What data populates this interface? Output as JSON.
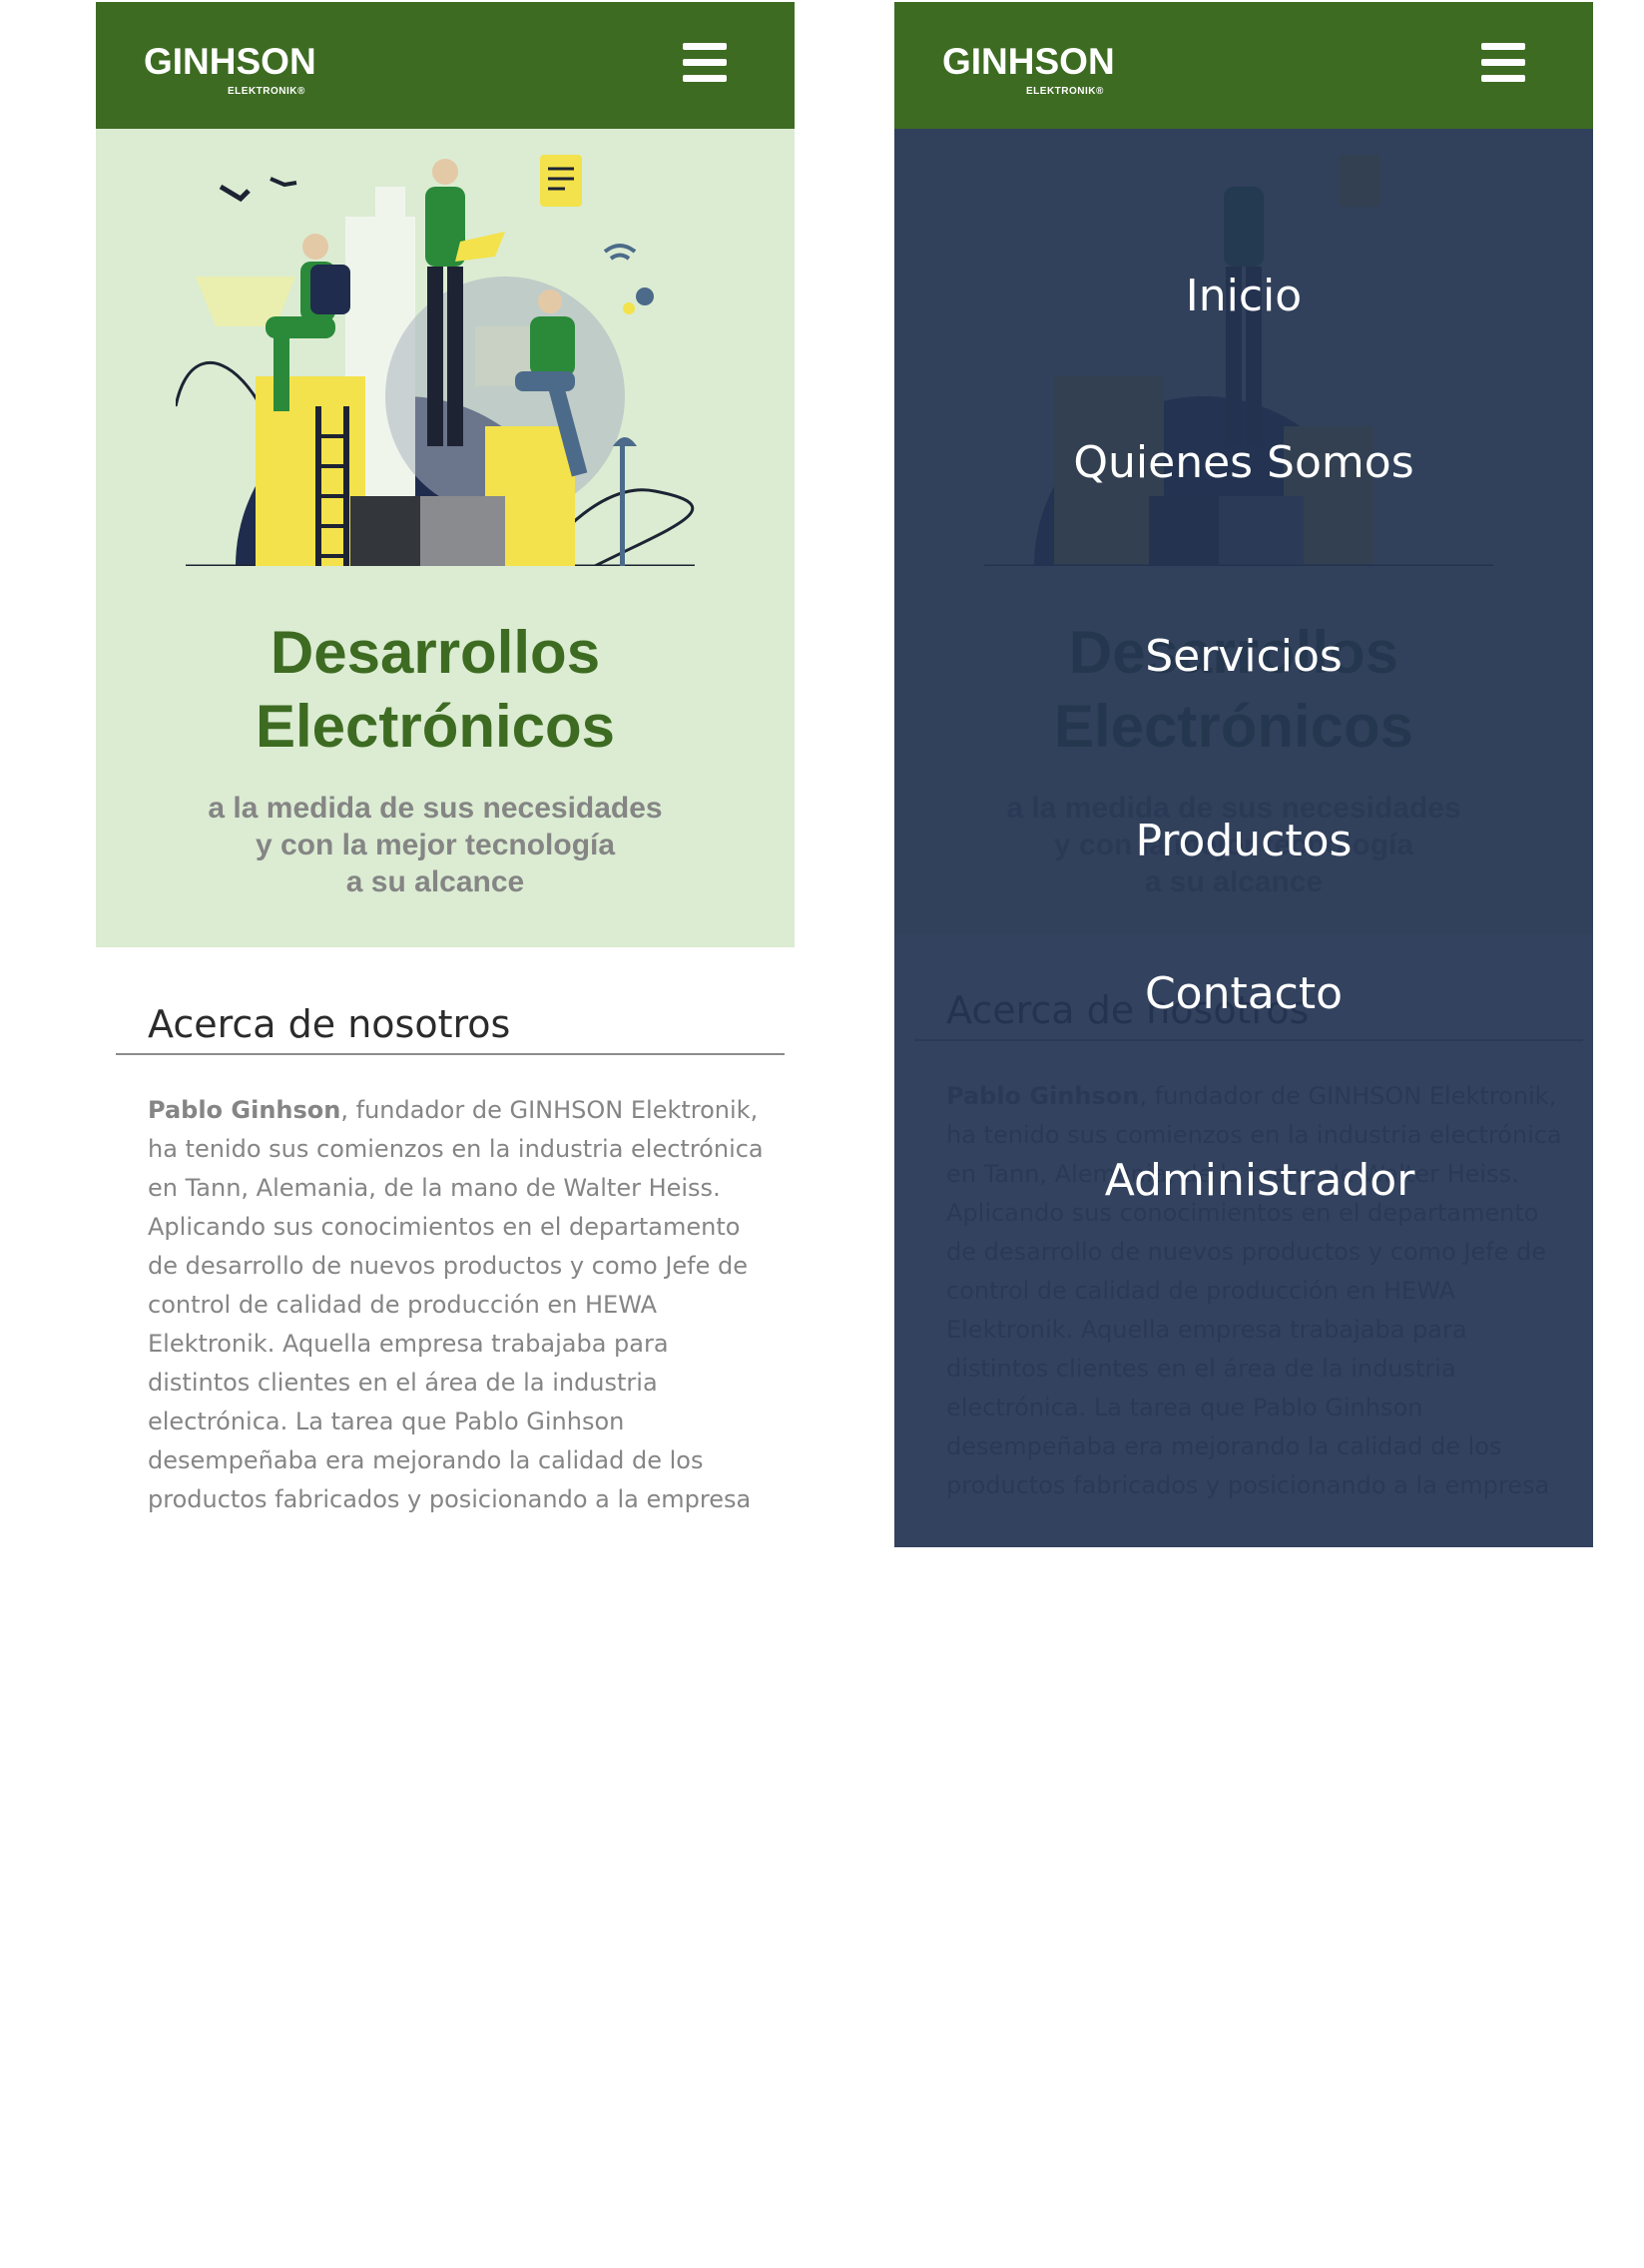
{
  "brand": {
    "logo_text": "GINHSON",
    "logo_sub": "ELEKTRONIK®",
    "header_color": "#3d6b22"
  },
  "hero": {
    "title_line1": "Desarrollos",
    "title_line2": "Electrónicos",
    "subtitle_line1": "a la medida de sus necesidades",
    "subtitle_line2": "y con la mejor tecnología",
    "subtitle_line3": "a su alcance",
    "background": "#dbecd2"
  },
  "about": {
    "heading": "Acerca de nosotros",
    "lead_name": "Pablo Ginhson",
    "body": ", fundador de GINHSON Elektronik, ha tenido sus comienzos en la industria electrónica en Tann, Alemania, de la mano de Walter Heiss. Aplicando sus conocimientos en el departamento de desarrollo de nuevos productos y como Jefe de control de calidad de producción en HEWA Elektronik. Aquella empresa trabajaba para distintos clientes en el área de la industria electrónica. La tarea que Pablo Ginhson desempeñaba era mejorando la calidad de los productos fabricados y posicionando a la empresa"
  },
  "menu": {
    "items": [
      {
        "label": "Inicio"
      },
      {
        "label": "Quienes Somos"
      },
      {
        "label": "Servicios"
      },
      {
        "label": "Productos"
      },
      {
        "label": "Contacto"
      },
      {
        "label": "Administrador"
      }
    ],
    "overlay_color": "#243452"
  },
  "icons": {
    "menu": "hamburger-icon",
    "illustration": "team-illustration"
  }
}
